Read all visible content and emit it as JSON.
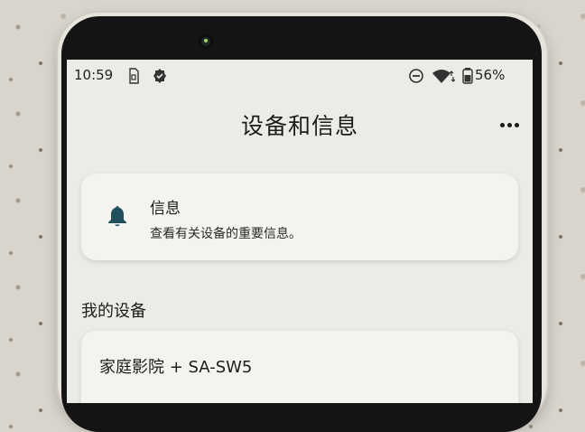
{
  "status_bar": {
    "time": "10:59",
    "battery_percent": "56%",
    "left_icons": [
      "sim-card-icon",
      "settings-badge-icon"
    ],
    "right_icons": [
      "do-not-disturb-icon",
      "wifi-icon",
      "battery-icon"
    ]
  },
  "header": {
    "title": "设备和信息",
    "overflow_icon": "more-horizontal-icon"
  },
  "info_card": {
    "icon": "bell-icon",
    "title": "信息",
    "description": "查看有关设备的重要信息。"
  },
  "devices_section": {
    "title": "我的设备",
    "devices": [
      {
        "name": "家庭影院 + SA-SW5"
      }
    ]
  },
  "colors": {
    "screen_background": "#edebe6",
    "card_background": "#f4f3ef",
    "accent_icon": "#1f4f5a",
    "text_primary": "#1c1c1c"
  }
}
